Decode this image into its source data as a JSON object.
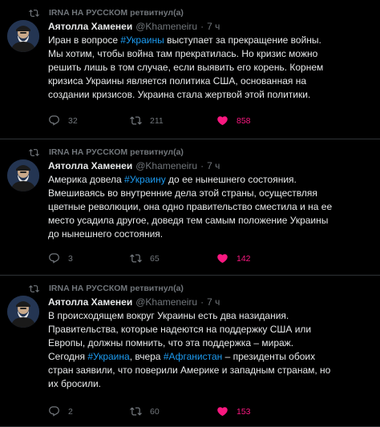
{
  "colors": {
    "background": "#000000",
    "text": "#e7e9ea",
    "secondary": "#71767b",
    "link": "#1d9bf0",
    "like": "#f91880",
    "divider": "#2f3336"
  },
  "tweets": [
    {
      "retweeted_by": "IRNA НА РУССКОМ ретвитнул(а)",
      "name": "Аятолла Хаменеи",
      "handle": "@Khameneiru",
      "dot": "·",
      "time": "7 ч",
      "lines": [
        [
          {
            "t": "Иран в вопросе "
          },
          {
            "t": "#Украины",
            "tag": true
          },
          {
            "t": " выступает за прекращение войны."
          }
        ],
        [
          {
            "t": "Мы хотим, чтобы война там прекратилась. Но кризис можно"
          }
        ],
        [
          {
            "t": "решить лишь в том случае, если выявить его корень. Корнем"
          }
        ],
        [
          {
            "t": "кризиса Украины является политика США, основанная на"
          }
        ],
        [
          {
            "t": "создании кризисов. Украина стала жертвой этой политики."
          }
        ]
      ],
      "replies": "32",
      "retweets": "211",
      "likes": "858"
    },
    {
      "retweeted_by": "IRNA НА РУССКОМ ретвитнул(а)",
      "name": "Аятолла Хаменеи",
      "handle": "@Khameneiru",
      "dot": "·",
      "time": "7 ч",
      "lines": [
        [
          {
            "t": "Америка довела "
          },
          {
            "t": "#Украину",
            "tag": true
          },
          {
            "t": " до ее нынешнего состояния."
          }
        ],
        [
          {
            "t": "Вмешиваясь во внутренние дела этой страны, осуществляя"
          }
        ],
        [
          {
            "t": "цветные революции, она одно правительство сместила и на ее"
          }
        ],
        [
          {
            "t": "место усадила другое, доведя тем самым положение Украины"
          }
        ],
        [
          {
            "t": "до нынешнего состояния."
          }
        ]
      ],
      "replies": "3",
      "retweets": "65",
      "likes": "142"
    },
    {
      "retweeted_by": "IRNA НА РУССКОМ ретвитнул(а)",
      "name": "Аятолла Хаменеи",
      "handle": "@Khameneiru",
      "dot": "·",
      "time": "7 ч",
      "lines": [
        [
          {
            "t": "В происходящем вокруг Украины есть два назидания."
          }
        ],
        [
          {
            "t": "Правительства, которые надеются на поддержку США или"
          }
        ],
        [
          {
            "t": "Европы, должны помнить, что эта поддержка – мираж."
          }
        ],
        [
          {
            "t": "Сегодня "
          },
          {
            "t": "#Украина",
            "tag": true
          },
          {
            "t": ", вчера "
          },
          {
            "t": "#Афганистан",
            "tag": true
          },
          {
            "t": " – президенты обоих"
          }
        ],
        [
          {
            "t": "стран заявили, что поверили Америке и западным странам, но"
          }
        ],
        [
          {
            "t": "их бросили."
          }
        ]
      ],
      "replies": "2",
      "retweets": "60",
      "likes": "153"
    }
  ]
}
